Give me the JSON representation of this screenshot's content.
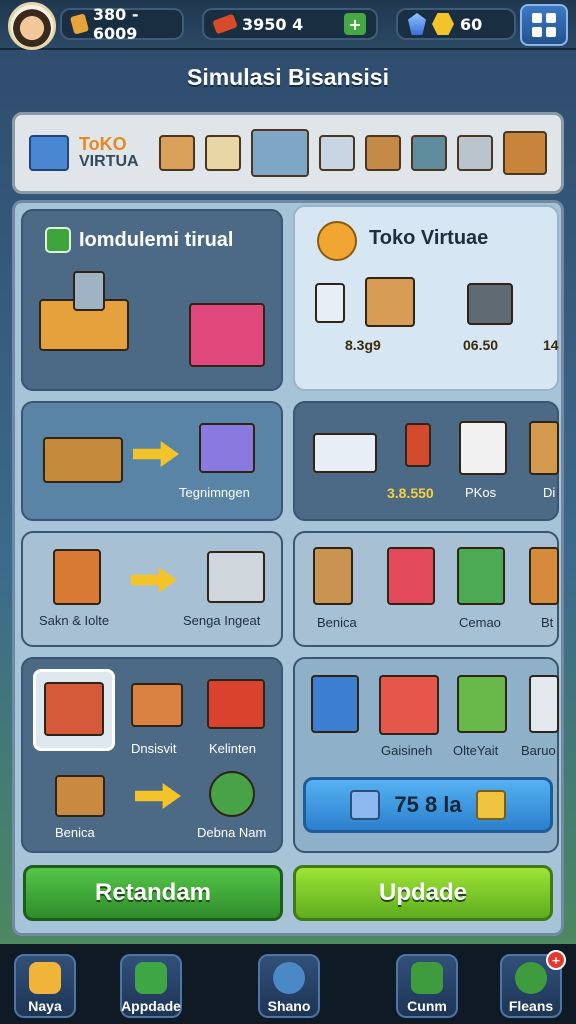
{
  "resources": {
    "gold": "380 - 6009",
    "tickets": "3950 4",
    "gems_coins": "60"
  },
  "title": "Simulasi Bisansisi",
  "shelf": {
    "logo_line1": "ToKO",
    "logo_line2": "VIRTUA"
  },
  "panels": {
    "p1": {
      "title": "Iomdulemi tirual"
    },
    "p2": {
      "title": "Toko Virtuae",
      "price_left": "8.3g9",
      "price_right": "06.50",
      "price_edge": "14"
    },
    "p3": {
      "label": "Tegnimngen"
    },
    "p4": {
      "price": "3.8.550",
      "label": "PKos",
      "label_edge": "Di"
    },
    "p5": {
      "label_left": "Sakn & Iolte",
      "label_right": "Senga Ingeat"
    },
    "p6": {
      "label_left": "Benica",
      "label_mid": "Cemao",
      "label_edge": "Bt"
    },
    "p7": {
      "label_a": "Dnsisvit",
      "label_b": "Kelinten",
      "label_c": "Benica",
      "label_d": "Debna Nam"
    },
    "p8": {
      "label_a": "Gaisineh",
      "label_b": "OlteYait",
      "label_c": "Baruo"
    }
  },
  "price_button": {
    "value": "75 8 la"
  },
  "buttons": {
    "left": "Retandam",
    "right": "Updade"
  },
  "nav": [
    {
      "label": "Naya",
      "icon": "tools-icon"
    },
    {
      "label": "Appdade",
      "icon": "upgrade-icon"
    },
    {
      "label": "Shano",
      "icon": "compass-icon"
    },
    {
      "label": "Cunm",
      "icon": "register-icon"
    },
    {
      "label": "Fleans",
      "icon": "settings-icon",
      "badge": "+"
    }
  ],
  "colors": {
    "accent_green": "#2f8d2c",
    "accent_lime": "#5ead1e",
    "accent_blue": "#2c7fcc",
    "price_yellow": "#f5d33b"
  }
}
